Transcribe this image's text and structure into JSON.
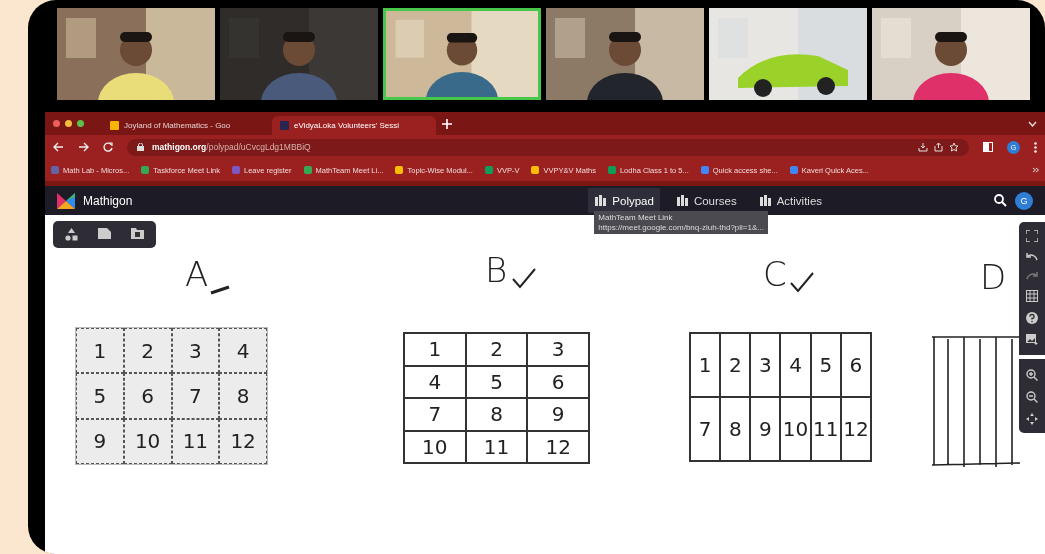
{
  "meeting": {
    "participants": [
      {
        "kind": "picture",
        "speaking": false
      },
      {
        "kind": "picture",
        "speaking": false
      },
      {
        "kind": "picture",
        "speaking": true
      },
      {
        "kind": "picture",
        "speaking": false
      },
      {
        "kind": "picture",
        "speaking": false
      },
      {
        "kind": "picture",
        "speaking": false
      }
    ]
  },
  "browser": {
    "tabs": [
      {
        "title": "Joyland of Mathematics - Goo",
        "kind": "slides",
        "selected": false
      },
      {
        "title": "eVidyaLoka Volunteers' Sessi",
        "kind": "mathigon",
        "selected": true
      }
    ],
    "url_host": "mathigon.org",
    "url_path": "/polypad/uCvcgLdg1MBBiQ",
    "profile_initial": "G",
    "bookmarks": [
      {
        "label": "Math Lab - Micros...",
        "kind": "teams"
      },
      {
        "label": "Taskforce Meet Link",
        "kind": "meet"
      },
      {
        "label": "Leave register",
        "kind": "form"
      },
      {
        "label": "MathTeam Meet Li...",
        "kind": "meet"
      },
      {
        "label": "Topic-Wise Modul...",
        "kind": "drive"
      },
      {
        "label": "VVP-V",
        "kind": "sheet"
      },
      {
        "label": "VVPY&V Maths",
        "kind": "drive"
      },
      {
        "label": "Lodha Class 1 to 5...",
        "kind": "sheet"
      },
      {
        "label": "Quick access she...",
        "kind": "doc"
      },
      {
        "label": "Kaveri Quick Aces...",
        "kind": "doc"
      }
    ]
  },
  "app": {
    "name": "Mathigon",
    "nav": [
      {
        "label": "Polypad",
        "selected": true
      },
      {
        "label": "Courses",
        "selected": false
      },
      {
        "label": "Activities",
        "selected": false
      }
    ],
    "profile_initial": "G",
    "tooltip": {
      "title": "MathTeam Meet Link",
      "url": "https://meet.google.com/bnq-ziuh-thd?pli=1&..."
    }
  },
  "canvas": {
    "drawings": [
      {
        "label": "A",
        "kind": "grid",
        "dashed": true,
        "annotation": {
          "kind": "dash"
        },
        "rows": [
          [
            "1",
            "2",
            "3",
            "4"
          ],
          [
            "5",
            "6",
            "7",
            "8"
          ],
          [
            "9",
            "10",
            "11",
            "12"
          ]
        ]
      },
      {
        "label": "B",
        "kind": "grid",
        "dashed": false,
        "annotation": {
          "kind": "check"
        },
        "rows": [
          [
            "1",
            "2",
            "3"
          ],
          [
            "4",
            "5",
            "6"
          ],
          [
            "7",
            "8",
            "9"
          ],
          [
            "10",
            "11",
            "12"
          ]
        ]
      },
      {
        "label": "C",
        "kind": "grid",
        "dashed": false,
        "annotation": {
          "kind": "check"
        },
        "rows": [
          [
            "1",
            "2",
            "3",
            "4",
            "5",
            "6"
          ],
          [
            "7",
            "8",
            "9",
            "10",
            "11",
            "12"
          ]
        ]
      },
      {
        "label": "D",
        "kind": "lines"
      }
    ]
  }
}
